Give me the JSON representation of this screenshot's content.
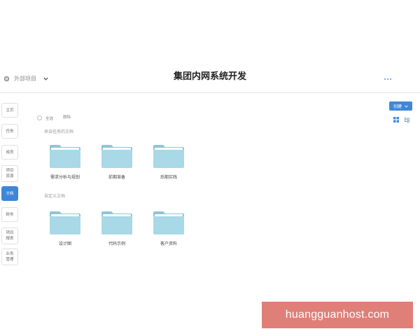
{
  "header": {
    "project_switch": "外部项目",
    "title": "集团内网系统开发"
  },
  "sidebar": {
    "items": [
      {
        "label": "主页",
        "active": false
      },
      {
        "label": "任务",
        "active": false
      },
      {
        "label": "成员",
        "active": false
      },
      {
        "label": "项目 资源",
        "active": false
      },
      {
        "label": "文档",
        "active": true
      },
      {
        "label": "财务",
        "active": false
      },
      {
        "label": "项目 报表",
        "active": false
      },
      {
        "label": "业务 管理",
        "active": false
      }
    ]
  },
  "toolbar": {
    "create_label": "创建",
    "select_all_label": "全选",
    "delete_label": "删除"
  },
  "sections": [
    {
      "title": "来自任务的文档",
      "folders": [
        "需求分析与规划",
        "前期准备",
        "后期实践"
      ]
    },
    {
      "title": "自定义文档",
      "folders": [
        "设计图",
        "代码示例",
        "客户资料"
      ]
    }
  ],
  "icons": {
    "project_switch": "globe-icon",
    "dropdown": "chevron-down-icon",
    "more": "more-horizontal-icon",
    "grid_view": "grid-view-icon",
    "tree_view": "tree-view-icon",
    "folder": "folder-icon"
  },
  "colors": {
    "accent": "#3d86d9",
    "folder": "#a9d8e6",
    "watermark_bg": "#e07e78"
  },
  "watermark": "huangguanhost.com"
}
